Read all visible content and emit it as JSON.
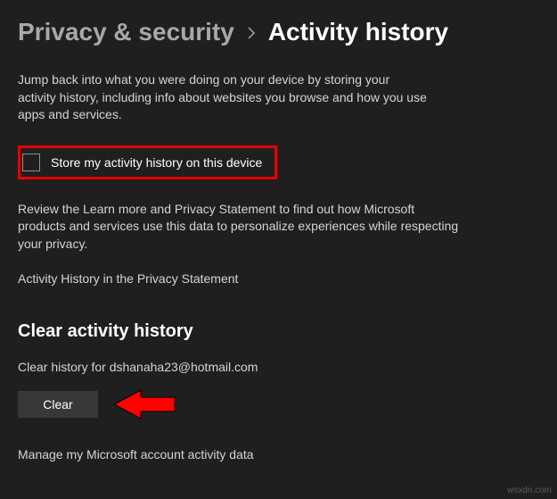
{
  "breadcrumb": {
    "parent": "Privacy & security",
    "current": "Activity history"
  },
  "intro": "Jump back into what you were doing on your device by storing your activity history, including info about websites you browse and how you use apps and services.",
  "checkbox": {
    "label": "Store my activity history on this device",
    "checked": false
  },
  "review": "Review the Learn more and Privacy Statement to find out how Microsoft products and services use this data to personalize experiences while respecting your privacy.",
  "privacy_link": "Activity History in the Privacy Statement",
  "clear_section": {
    "heading": "Clear activity history",
    "label": "Clear history for dshanaha23@hotmail.com",
    "button": "Clear"
  },
  "manage_link": "Manage my Microsoft account activity data",
  "watermark": "wsxdn.com",
  "colors": {
    "highlight_border": "#e60000",
    "arrow_fill": "#ff0000"
  }
}
